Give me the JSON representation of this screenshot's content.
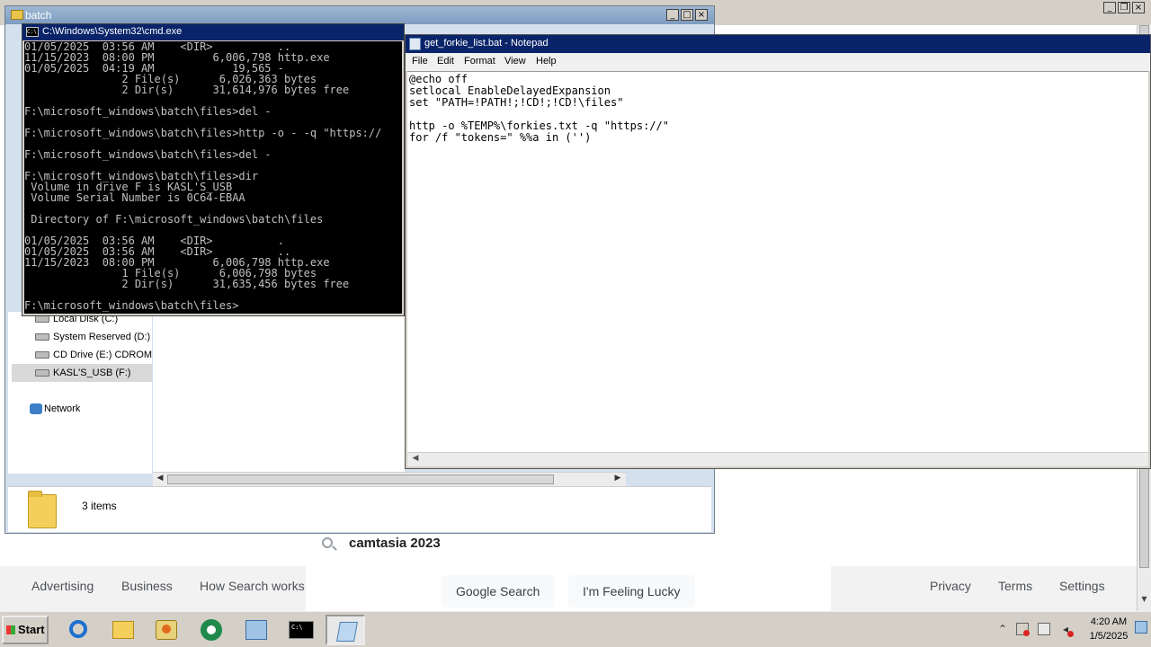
{
  "explorer": {
    "title": "batch",
    "nav_items": [
      {
        "label": "Local Disk (C:)"
      },
      {
        "label": "System Reserved (D:)"
      },
      {
        "label": "CD Drive (E:) CDROM"
      },
      {
        "label": "KASL'S_USB (F:)"
      }
    ],
    "network_label": "Network",
    "items_count": "3 items"
  },
  "cmd": {
    "title": "C:\\Windows\\System32\\cmd.exe",
    "lines": [
      "01/05/2025  03:56 AM    <DIR>          ..",
      "11/15/2023  08:00 PM         6,006,798 http.exe",
      "01/05/2025  04:19 AM            19,565 -",
      "               2 File(s)      6,026,363 bytes",
      "               2 Dir(s)      31,614,976 bytes free",
      "",
      "F:\\microsoft_windows\\batch\\files>del -",
      "",
      "F:\\microsoft_windows\\batch\\files>http -o - -q \"https://",
      "",
      "F:\\microsoft_windows\\batch\\files>del -",
      "",
      "F:\\microsoft_windows\\batch\\files>dir",
      " Volume in drive F is KASL'S_USB",
      " Volume Serial Number is 0C64-EBAA",
      "",
      " Directory of F:\\microsoft_windows\\batch\\files",
      "",
      "01/05/2025  03:56 AM    <DIR>          .",
      "01/05/2025  03:56 AM    <DIR>          ..",
      "11/15/2023  08:00 PM         6,006,798 http.exe",
      "               1 File(s)      6,006,798 bytes",
      "               2 Dir(s)      31,635,456 bytes free",
      "",
      "F:\\microsoft_windows\\batch\\files>"
    ]
  },
  "notepad": {
    "title": "get_forkie_list.bat - Notepad",
    "menu": [
      "File",
      "Edit",
      "Format",
      "View",
      "Help"
    ],
    "lines": [
      "@echo off",
      "setlocal EnableDelayedExpansion",
      "set \"PATH=!PATH!;!CD!;!CD!\\files\"",
      "",
      "http -o %TEMP%\\forkies.txt -q \"https://\"",
      "for /f \"tokens=\" %%a in ('')"
    ]
  },
  "google": {
    "search_query": "camtasia 2023",
    "search_button": "Google Search",
    "lucky_button": "I'm Feeling Lucky",
    "footer_left": [
      "Advertising",
      "Business",
      "How Search works"
    ],
    "footer_right": [
      "Privacy",
      "Terms",
      "Settings"
    ]
  },
  "window_controls": {
    "minimize": "_",
    "maximize": "□",
    "close": "×",
    "restore": "❐"
  },
  "taskbar": {
    "start_label": "Start",
    "apps": [
      {
        "icon": "internet-explorer-icon"
      },
      {
        "icon": "folder-icon"
      },
      {
        "icon": "media-player-icon"
      },
      {
        "icon": "camtasia-icon"
      },
      {
        "icon": "control-panel-icon"
      },
      {
        "icon": "cmd-icon",
        "label": "C:\\"
      },
      {
        "icon": "notepad-icon"
      }
    ],
    "tray_chevron": "⌃",
    "clock_time": "4:20 AM",
    "clock_date": "1/5/2025"
  }
}
